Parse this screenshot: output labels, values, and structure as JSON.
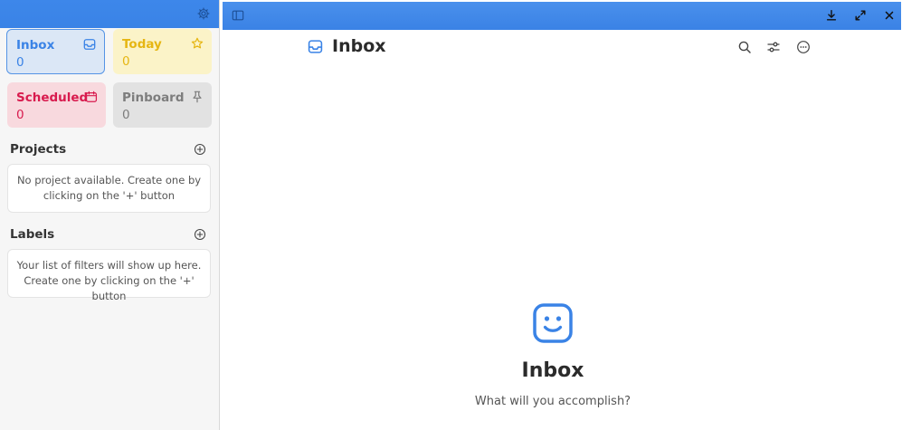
{
  "sidebar": {
    "settings_icon": "gear-icon",
    "tiles": {
      "inbox": {
        "label": "Inbox",
        "count": "0",
        "icon": "inbox-icon",
        "color": "#3a83e6"
      },
      "today": {
        "label": "Today",
        "count": "0",
        "icon": "star-icon",
        "color": "#e6b613"
      },
      "scheduled": {
        "label": "Scheduled",
        "count": "0",
        "icon": "calendar-icon",
        "color": "#d81b4e"
      },
      "pinboard": {
        "label": "Pinboard",
        "count": "0",
        "icon": "pin-icon",
        "color": "#7d7d7d"
      }
    },
    "projects": {
      "title": "Projects",
      "empty_line1": "No project available. Create one by",
      "empty_line2": "clicking on the '+' button"
    },
    "labels": {
      "title": "Labels",
      "empty_line1": "Your list of filters will show up here.",
      "empty_line2": "Create one by clicking on the '+' button"
    }
  },
  "header": {
    "sidebar_toggle_icon": "sidebar-toggle-icon",
    "window_controls": [
      "download-icon",
      "maximize-icon",
      "close-icon"
    ],
    "accent": "#3a83e6"
  },
  "main": {
    "title": "Inbox",
    "title_icon": "inbox-icon",
    "toolbar": [
      "search-icon",
      "filter-sliders-icon",
      "more-options-icon"
    ],
    "empty_state": {
      "icon": "smiley-icon",
      "title": "Inbox",
      "subtitle": "What will you accomplish?"
    }
  }
}
